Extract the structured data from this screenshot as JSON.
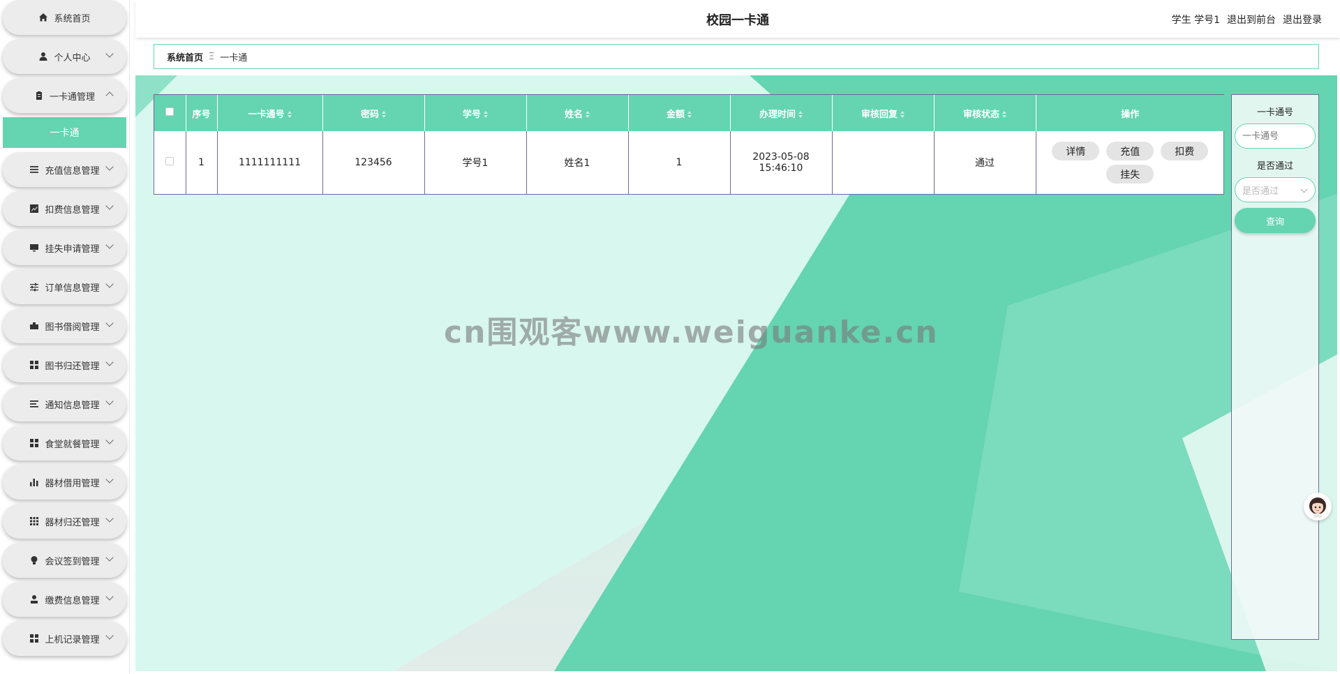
{
  "header": {
    "title": "校园一卡通",
    "user_role": "学生",
    "user_name": "学号1",
    "to_front": "退出到前台",
    "logout": "退出登录"
  },
  "sidebar": {
    "items": [
      {
        "label": "系统首页",
        "icon": "home-icon"
      },
      {
        "label": "个人中心",
        "icon": "user-icon"
      },
      {
        "label": "一卡通管理",
        "icon": "clipboard-icon",
        "expanded": true,
        "sub": [
          "一卡通"
        ]
      },
      {
        "label": "充值信息管理",
        "icon": "list-icon"
      },
      {
        "label": "扣费信息管理",
        "icon": "chart-icon"
      },
      {
        "label": "挂失申请管理",
        "icon": "monitor-icon"
      },
      {
        "label": "订单信息管理",
        "icon": "sliders-icon"
      },
      {
        "label": "图书借阅管理",
        "icon": "book-icon"
      },
      {
        "label": "图书归还管理",
        "icon": "grid-icon"
      },
      {
        "label": "通知信息管理",
        "icon": "menu-icon"
      },
      {
        "label": "食堂就餐管理",
        "icon": "grid-icon"
      },
      {
        "label": "器材借用管理",
        "icon": "bar-chart-icon"
      },
      {
        "label": "器材归还管理",
        "icon": "apps-icon"
      },
      {
        "label": "会议签到管理",
        "icon": "bulb-icon"
      },
      {
        "label": "缴费信息管理",
        "icon": "person-icon"
      },
      {
        "label": "上机记录管理",
        "icon": "grid-icon"
      }
    ]
  },
  "breadcrumb": {
    "home": "系统首页",
    "separator": "Ξ",
    "current": "一卡通"
  },
  "table": {
    "columns": [
      "序号",
      "一卡通号",
      "密码",
      "学号",
      "姓名",
      "金额",
      "办理时间",
      "审核回复",
      "审核状态",
      "操作"
    ],
    "rows": [
      {
        "index": "1",
        "card_no": "1111111111",
        "password": "123456",
        "student_no": "学号1",
        "name": "姓名1",
        "amount": "1",
        "time": "2023-05-08 15:46:10",
        "reply": "",
        "status": "通过"
      }
    ],
    "actions": [
      "详情",
      "充值",
      "扣费",
      "挂失"
    ]
  },
  "search": {
    "card_label": "一卡通号",
    "card_placeholder": "一卡通号",
    "pass_label": "是否通过",
    "pass_placeholder": "是否通过",
    "button": "查询"
  },
  "watermark": "cn围观客www.weiguanke.cn",
  "colors": {
    "accent": "#65d4b0",
    "border": "#6a6a9a"
  }
}
